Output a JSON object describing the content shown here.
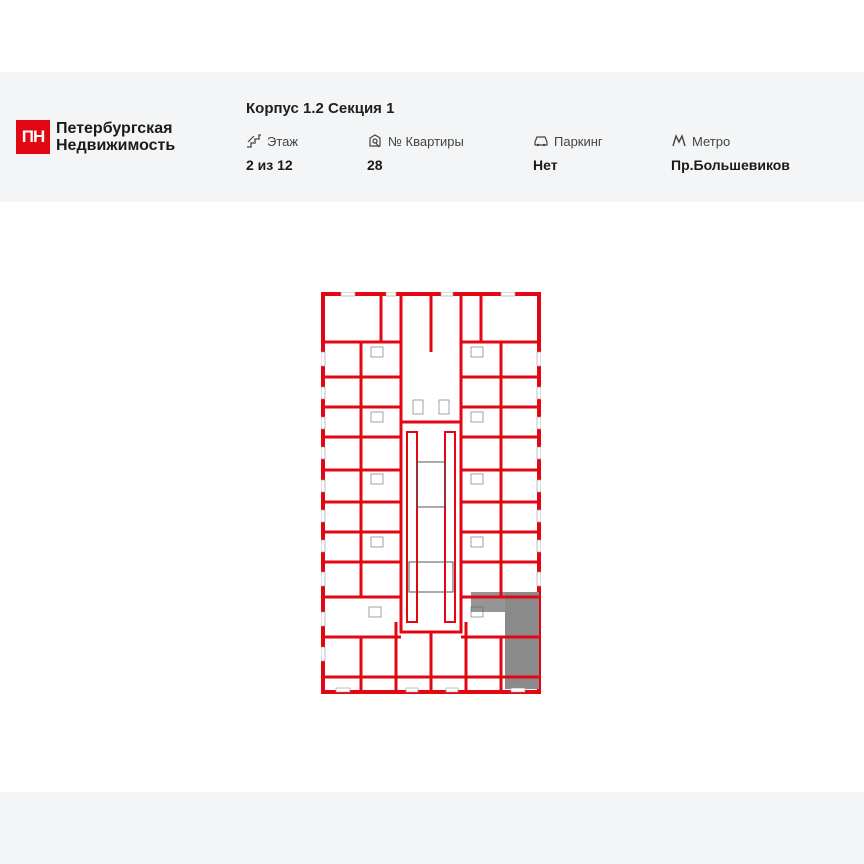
{
  "brand": {
    "logo_mark": "ПН",
    "line1": "Петербургская",
    "line2": "Недвижимость",
    "color": "#e30613"
  },
  "title": "Корпус 1.2 Секция 1",
  "fields": [
    {
      "label": "Этаж",
      "value": "2 из 12",
      "icon": "stairs-icon"
    },
    {
      "label": "№ Квартиры",
      "value": "28",
      "icon": "key-icon"
    },
    {
      "label": "Паркинг",
      "value": "Нет",
      "icon": "car-icon"
    },
    {
      "label": "Метро",
      "value": "Пр.Большевиков",
      "icon": "metro-icon"
    }
  ],
  "plan": {
    "highlight_color": "#8a8a8a",
    "wall_color": "#e30613"
  }
}
